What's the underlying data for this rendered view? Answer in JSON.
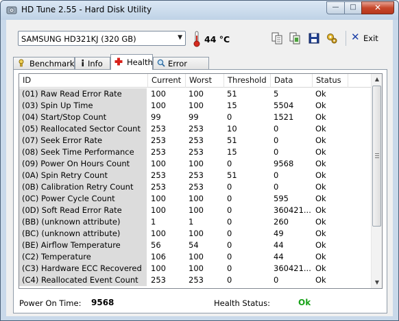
{
  "window": {
    "title": "HD Tune 2.55 - Hard Disk Utility"
  },
  "toolbar": {
    "drive": "SAMSUNG HD321KJ (320 GB)",
    "temperature": "44 °C",
    "exit_label": "Exit"
  },
  "tabs": [
    {
      "label": "Benchmark",
      "icon": "benchmark-icon",
      "active": false
    },
    {
      "label": "Info",
      "icon": "info-icon",
      "active": false
    },
    {
      "label": "Health",
      "icon": "health-cross-icon",
      "active": true
    },
    {
      "label": "Error Scan",
      "icon": "magnifier-icon",
      "active": false
    }
  ],
  "table": {
    "columns": [
      "ID",
      "Current",
      "Worst",
      "Threshold",
      "Data",
      "Status"
    ],
    "rows": [
      [
        "(01) Raw Read Error Rate",
        "100",
        "100",
        "51",
        "5",
        "Ok"
      ],
      [
        "(03) Spin Up Time",
        "100",
        "100",
        "15",
        "5504",
        "Ok"
      ],
      [
        "(04) Start/Stop Count",
        "99",
        "99",
        "0",
        "1521",
        "Ok"
      ],
      [
        "(05) Reallocated Sector Count",
        "253",
        "253",
        "10",
        "0",
        "Ok"
      ],
      [
        "(07) Seek Error Rate",
        "253",
        "253",
        "51",
        "0",
        "Ok"
      ],
      [
        "(08) Seek Time Performance",
        "253",
        "253",
        "15",
        "0",
        "Ok"
      ],
      [
        "(09) Power On Hours Count",
        "100",
        "100",
        "0",
        "9568",
        "Ok"
      ],
      [
        "(0A) Spin Retry Count",
        "253",
        "253",
        "51",
        "0",
        "Ok"
      ],
      [
        "(0B) Calibration Retry Count",
        "253",
        "253",
        "0",
        "0",
        "Ok"
      ],
      [
        "(0C) Power Cycle Count",
        "100",
        "100",
        "0",
        "595",
        "Ok"
      ],
      [
        "(0D) Soft Read Error Rate",
        "100",
        "100",
        "0",
        "360421...",
        "Ok"
      ],
      [
        "(BB) (unknown attribute)",
        "1",
        "1",
        "0",
        "260",
        "Ok"
      ],
      [
        "(BC) (unknown attribute)",
        "100",
        "100",
        "0",
        "49",
        "Ok"
      ],
      [
        "(BE) Airflow Temperature",
        "56",
        "54",
        "0",
        "44",
        "Ok"
      ],
      [
        "(C2) Temperature",
        "106",
        "100",
        "0",
        "44",
        "Ok"
      ],
      [
        "(C3) Hardware ECC Recovered",
        "100",
        "100",
        "0",
        "360421...",
        "Ok"
      ],
      [
        "(C4) Reallocated Event Count",
        "253",
        "253",
        "0",
        "0",
        "Ok"
      ]
    ]
  },
  "footer": {
    "power_on_label": "Power On Time:",
    "power_on_value": "9568",
    "health_label": "Health Status:",
    "health_value": "Ok",
    "health_color": "#1aa31a"
  }
}
